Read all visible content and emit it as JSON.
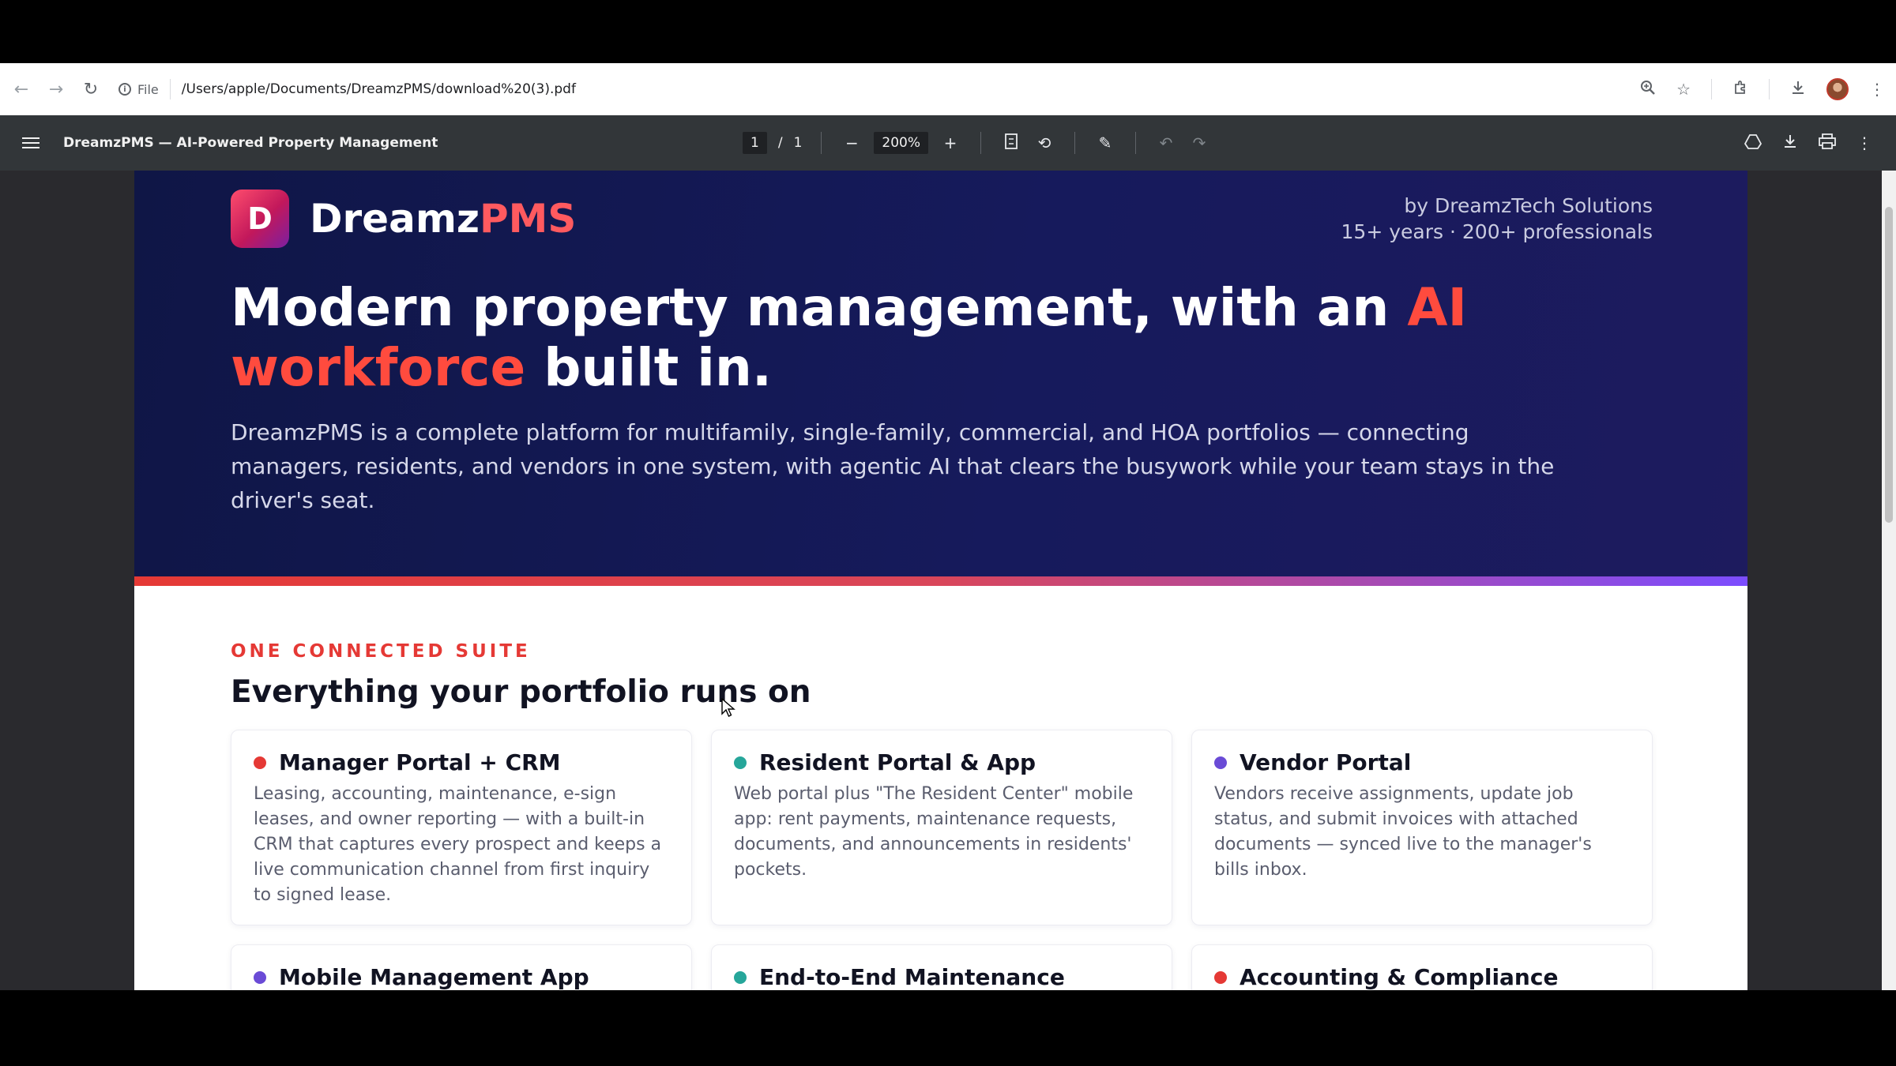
{
  "browser": {
    "info_label": "File",
    "url": "/Users/apple/Documents/DreamzPMS/download%20(3).pdf"
  },
  "pdf_toolbar": {
    "title": "DreamzPMS — AI-Powered Property Management",
    "page_current": "1",
    "page_separator": "/",
    "page_total": "1",
    "zoom": "200%"
  },
  "hero": {
    "logo_letter": "D",
    "brand_primary": "Dreamz",
    "brand_accent": "PMS",
    "byline_line1": "by DreamzTech Solutions",
    "byline_line2": "15+ years · 200+ professionals",
    "headline_part1": "Modern property management, with an ",
    "headline_accent": "AI workforce",
    "headline_part2": " built in.",
    "intro": "DreamzPMS is a complete platform for multifamily, single-family, commercial, and HOA portfolios — connecting managers, residents, and vendors in one system, with agentic AI that clears the busywork while your team stays in the driver's seat."
  },
  "suite": {
    "eyebrow": "ONE CONNECTED SUITE",
    "title": "Everything your portfolio runs on",
    "cards": [
      {
        "title": "Manager Portal + CRM",
        "dot_color": "#e53935",
        "body": "Leasing, accounting, maintenance, e-sign leases, and owner reporting — with a built-in CRM that captures every prospect and keeps a live communication channel from first inquiry to signed lease."
      },
      {
        "title": "Resident Portal & App",
        "dot_color": "#26a69a",
        "body": "Web portal plus \"The Resident Center\" mobile app: rent payments, maintenance requests, documents, and announcements in residents' pockets."
      },
      {
        "title": "Vendor Portal",
        "dot_color": "#6a4bd6",
        "body": "Vendors receive assignments, update job status, and submit invoices with attached documents — synced live to the manager's bills inbox."
      },
      {
        "title": "Mobile Management App",
        "dot_color": "#6a4bd6",
        "body": ""
      },
      {
        "title": "End-to-End Maintenance",
        "dot_color": "#26a69a",
        "body": ""
      },
      {
        "title": "Accounting & Compliance",
        "dot_color": "#e53935",
        "body": ""
      }
    ]
  },
  "colors": {
    "brand_accent": "#ff5a5f",
    "headline_accent": "#ff4b3e",
    "eyebrow": "#e53935",
    "hero_bg": "#131858"
  }
}
